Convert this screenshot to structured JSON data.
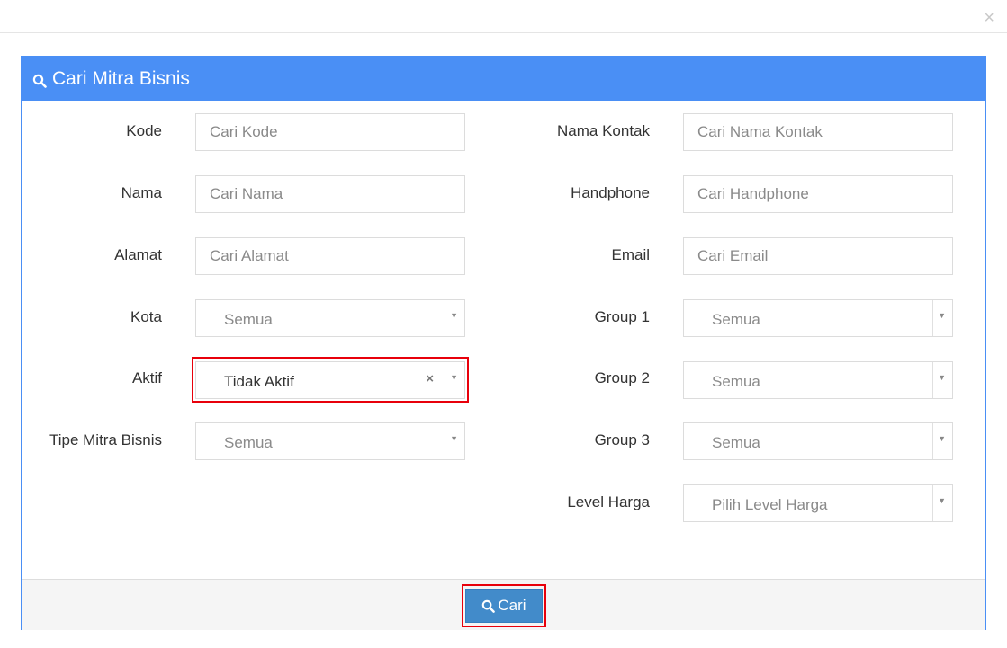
{
  "modal": {
    "close_symbol": "×"
  },
  "panel": {
    "title": "Cari Mitra Bisnis",
    "icon": "search-icon",
    "header_color": "#4a8ff5"
  },
  "form": {
    "left": [
      {
        "label": "Kode",
        "type": "text",
        "placeholder": "Cari Kode"
      },
      {
        "label": "Nama",
        "type": "text",
        "placeholder": "Cari Nama"
      },
      {
        "label": "Alamat",
        "type": "text",
        "placeholder": "Cari Alamat"
      },
      {
        "label": "Kota",
        "type": "select",
        "value": "Semua"
      },
      {
        "label": "Aktif",
        "type": "select",
        "value": "Tidak Aktif",
        "clear_symbol": "×"
      },
      {
        "label": "Tipe Mitra Bisnis",
        "type": "select",
        "value": "Semua"
      }
    ],
    "right": [
      {
        "label": "Nama Kontak",
        "type": "text",
        "placeholder": "Cari Nama Kontak"
      },
      {
        "label": "Handphone",
        "type": "text",
        "placeholder": "Cari Handphone"
      },
      {
        "label": "Email",
        "type": "text",
        "placeholder": "Cari Email"
      },
      {
        "label": "Group 1",
        "type": "select",
        "value": "Semua"
      },
      {
        "label": "Group 2",
        "type": "select",
        "value": "Semua"
      },
      {
        "label": "Group 3",
        "type": "select",
        "value": "Semua"
      },
      {
        "label": "Level Harga",
        "type": "select",
        "value": "Pilih Level Harga"
      }
    ]
  },
  "footer": {
    "search_label": "Cari",
    "button_color": "#428bca"
  },
  "highlight_color": "#e8000b"
}
